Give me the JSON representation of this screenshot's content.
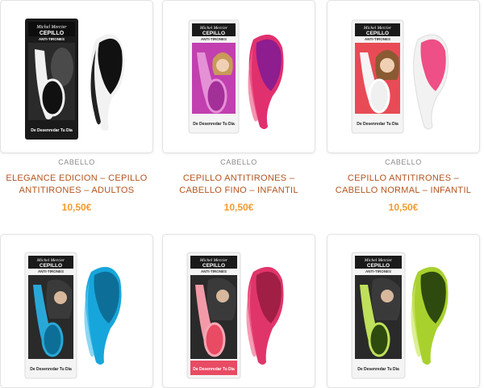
{
  "products": [
    {
      "category": "CABELLO",
      "title": "ELEGANCE EDICION – CEPILLO ANTITIRONES – ADULTOS",
      "price": "10,50€",
      "box": {
        "brand": "Michel Mercier",
        "line1": "CEPILLO",
        "line2": "ANTI-TIRONES",
        "slogan": "De Desenredar Tu Dia"
      },
      "colors": {
        "box": "#1a1a1a",
        "accent": "#111111",
        "brush": "#222222",
        "brushHighlight": "#f2f2f2",
        "bristle": "#111111"
      }
    },
    {
      "category": "CABELLO",
      "title": "CEPILLO ANTITIRONES – CABELLO FINO – INFANTIL",
      "price": "10,50€",
      "box": {
        "brand": "Michel Mercier",
        "line1": "CEPILLO",
        "line2": "ANTI-TIRONES",
        "slogan": "De Desenredar Tu Dia"
      },
      "colors": {
        "box": "#c23fb0",
        "accent": "#b23aa3",
        "brush": "#e0306e",
        "brushHighlight": "#f06890",
        "bristle": "#8e1d8f"
      }
    },
    {
      "category": "CABELLO",
      "title": "CEPILLO ANTITIRONES – CABELLO NORMAL – INFANTIL",
      "price": "10,50€",
      "box": {
        "brand": "Michel Mercier",
        "line1": "CEPILLO",
        "line2": "ANTI-TIRONES",
        "slogan": "De Desenredar Tu Dia"
      },
      "colors": {
        "box": "#e84b55",
        "accent": "#e04752",
        "brush": "#f2f2f2",
        "brushHighlight": "#ffffff",
        "bristle": "#ee4f86"
      }
    },
    {
      "category": "",
      "title": "",
      "price": "",
      "box": {
        "brand": "Michel Mercier",
        "line1": "CEPILLO",
        "line2": "ANTI-TIRONES",
        "slogan": "De Desenredar Tu Dia"
      },
      "colors": {
        "box": "#29a8d8",
        "accent": "#2d9fd2",
        "brush": "#17a6db",
        "brushHighlight": "#5cc6ef",
        "bristle": "#0d6f98"
      }
    },
    {
      "category": "",
      "title": "",
      "price": "",
      "box": {
        "brand": "Michel Mercier",
        "line1": "CEPILLO",
        "line2": "ANTI-TIRONES",
        "slogan": "De Desenredar Tu Dia"
      },
      "colors": {
        "box": "#e84b63",
        "accent": "#e6506a",
        "brush": "#e0356b",
        "brushHighlight": "#f47095",
        "bristle": "#a11e45"
      }
    },
    {
      "category": "",
      "title": "",
      "price": "",
      "box": {
        "brand": "Michel Mercier",
        "line1": "CEPILLO",
        "line2": "ANTI-TIRONES",
        "slogan": "De Desenredar Tu Dia"
      },
      "colors": {
        "box": "#a4c93a",
        "accent": "#9cc23b",
        "brush": "#a8d12e",
        "brushHighlight": "#cde86a",
        "bristle": "#2f4a0e"
      }
    }
  ]
}
